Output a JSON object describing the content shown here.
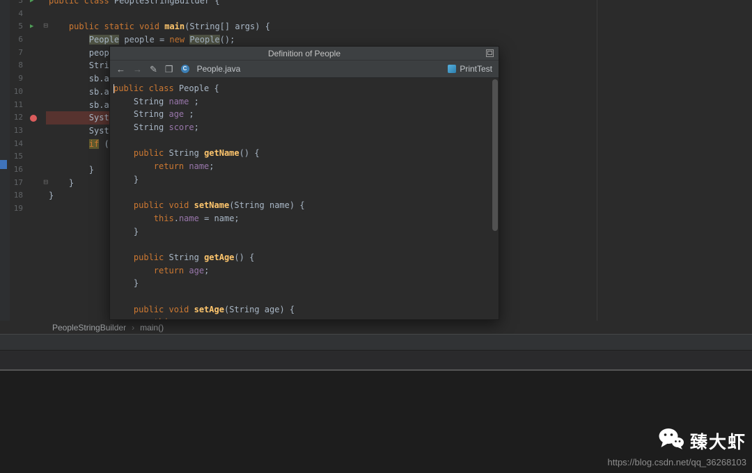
{
  "editor": {
    "lines": [
      {
        "num": 3,
        "run": true,
        "segments": [
          {
            "t": "public class ",
            "cls": "kw"
          },
          {
            "t": "PeopleStringBuilder {",
            "cls": "def"
          }
        ]
      },
      {
        "num": 4,
        "segments": []
      },
      {
        "num": 5,
        "run": true,
        "fold": true,
        "segments": [
          {
            "t": "    ",
            "cls": "def"
          },
          {
            "t": "public static void ",
            "cls": "kw"
          },
          {
            "t": "main",
            "cls": "fn"
          },
          {
            "t": "(String[] args) {",
            "cls": "def"
          }
        ]
      },
      {
        "num": 6,
        "segments": [
          {
            "t": "        ",
            "cls": "def"
          },
          {
            "t": "People",
            "cls": "hl"
          },
          {
            "t": " people = ",
            "cls": "def"
          },
          {
            "t": "new ",
            "cls": "kw"
          },
          {
            "t": "People",
            "cls": "hl"
          },
          {
            "t": "();",
            "cls": "def"
          }
        ]
      },
      {
        "num": 7,
        "segments": [
          {
            "t": "        peopl",
            "cls": "def"
          }
        ]
      },
      {
        "num": 8,
        "segments": [
          {
            "t": "        Strin",
            "cls": "def"
          }
        ]
      },
      {
        "num": 9,
        "segments": [
          {
            "t": "        sb.ap",
            "cls": "def"
          }
        ]
      },
      {
        "num": 10,
        "segments": [
          {
            "t": "        sb.ap",
            "cls": "def"
          }
        ]
      },
      {
        "num": 11,
        "segments": [
          {
            "t": "        sb.ap",
            "cls": "def"
          }
        ]
      },
      {
        "num": 12,
        "breakpoint": true,
        "bp_line": true,
        "segments": [
          {
            "t": "        Syste",
            "cls": "def"
          }
        ]
      },
      {
        "num": 13,
        "segments": [
          {
            "t": "        Syste",
            "cls": "def"
          }
        ]
      },
      {
        "num": 14,
        "segments": [
          {
            "t": "        ",
            "cls": "def"
          },
          {
            "t": "if",
            "cls": "kwh"
          },
          {
            "t": " (",
            "cls": "def"
          }
        ]
      },
      {
        "num": 15,
        "segments": []
      },
      {
        "num": 16,
        "segments": [
          {
            "t": "        }",
            "cls": "def"
          }
        ]
      },
      {
        "num": 17,
        "fold": true,
        "segments": [
          {
            "t": "    }",
            "cls": "def"
          }
        ]
      },
      {
        "num": 18,
        "segments": [
          {
            "t": "}",
            "cls": "def"
          }
        ]
      },
      {
        "num": 19,
        "segments": []
      }
    ]
  },
  "popup": {
    "title": "Definition of People",
    "toolbar": {
      "file": "People.java",
      "file_icon_letter": "C",
      "context": "PrintTest"
    },
    "code_lines": [
      {
        "caret": true,
        "segments": [
          {
            "t": "public class ",
            "cls": "kw"
          },
          {
            "t": "People {",
            "cls": "def"
          }
        ]
      },
      {
        "segments": [
          {
            "t": "    String ",
            "cls": "def"
          },
          {
            "t": "name",
            "cls": "field"
          },
          {
            "t": " ;",
            "cls": "def"
          }
        ]
      },
      {
        "segments": [
          {
            "t": "    String ",
            "cls": "def"
          },
          {
            "t": "age",
            "cls": "field"
          },
          {
            "t": " ;",
            "cls": "def"
          }
        ]
      },
      {
        "segments": [
          {
            "t": "    String ",
            "cls": "def"
          },
          {
            "t": "score",
            "cls": "field"
          },
          {
            "t": ";",
            "cls": "def"
          }
        ]
      },
      {
        "segments": []
      },
      {
        "segments": [
          {
            "t": "    ",
            "cls": "def"
          },
          {
            "t": "public ",
            "cls": "kw"
          },
          {
            "t": "String ",
            "cls": "def"
          },
          {
            "t": "getName",
            "cls": "fn"
          },
          {
            "t": "() {",
            "cls": "def"
          }
        ]
      },
      {
        "segments": [
          {
            "t": "        ",
            "cls": "def"
          },
          {
            "t": "return ",
            "cls": "kw"
          },
          {
            "t": "name",
            "cls": "field"
          },
          {
            "t": ";",
            "cls": "def"
          }
        ]
      },
      {
        "segments": [
          {
            "t": "    }",
            "cls": "def"
          }
        ]
      },
      {
        "segments": []
      },
      {
        "segments": [
          {
            "t": "    ",
            "cls": "def"
          },
          {
            "t": "public void ",
            "cls": "kw"
          },
          {
            "t": "setName",
            "cls": "fn"
          },
          {
            "t": "(String name) {",
            "cls": "def"
          }
        ]
      },
      {
        "segments": [
          {
            "t": "        ",
            "cls": "def"
          },
          {
            "t": "this",
            "cls": "kw"
          },
          {
            "t": ".",
            "cls": "def"
          },
          {
            "t": "name",
            "cls": "field"
          },
          {
            "t": " = name;",
            "cls": "def"
          }
        ]
      },
      {
        "segments": [
          {
            "t": "    }",
            "cls": "def"
          }
        ]
      },
      {
        "segments": []
      },
      {
        "segments": [
          {
            "t": "    ",
            "cls": "def"
          },
          {
            "t": "public ",
            "cls": "kw"
          },
          {
            "t": "String ",
            "cls": "def"
          },
          {
            "t": "getAge",
            "cls": "fn"
          },
          {
            "t": "() {",
            "cls": "def"
          }
        ]
      },
      {
        "segments": [
          {
            "t": "        ",
            "cls": "def"
          },
          {
            "t": "return ",
            "cls": "kw"
          },
          {
            "t": "age",
            "cls": "field"
          },
          {
            "t": ";",
            "cls": "def"
          }
        ]
      },
      {
        "segments": [
          {
            "t": "    }",
            "cls": "def"
          }
        ]
      },
      {
        "segments": []
      },
      {
        "segments": [
          {
            "t": "    ",
            "cls": "def"
          },
          {
            "t": "public void ",
            "cls": "kw"
          },
          {
            "t": "setAge",
            "cls": "fn"
          },
          {
            "t": "(String age) {",
            "cls": "def"
          }
        ]
      },
      {
        "segments": [
          {
            "t": "        ",
            "cls": "def"
          },
          {
            "t": "this",
            "cls": "kw"
          },
          {
            "t": ".",
            "cls": "def"
          },
          {
            "t": "age",
            "cls": "field"
          },
          {
            "t": " = age;",
            "cls": "def"
          }
        ]
      }
    ],
    "icons": {
      "back": "←",
      "forward": "→",
      "edit": "✎",
      "source": "❐"
    }
  },
  "breadcrumb": {
    "root": "PeopleStringBuilder",
    "separator": "›",
    "method": "main()"
  },
  "watermark": {
    "name": "臻大虾",
    "url": "https://blog.csdn.net/qq_36268103"
  },
  "colors": {
    "editor_bg": "#2b2b2b",
    "panel_bg": "#3c3f41",
    "keyword": "#cc7832",
    "method": "#ffc66d",
    "field": "#9876aa",
    "text": "#a9b7c6",
    "line_number": "#606366",
    "breakpoint_line": "#57332f",
    "breakpoint_dot": "#db5c5c",
    "run_arrow": "#4f9e58",
    "identifier_highlight": "#4e5243",
    "class_icon_blue": "#3c7fb5"
  }
}
